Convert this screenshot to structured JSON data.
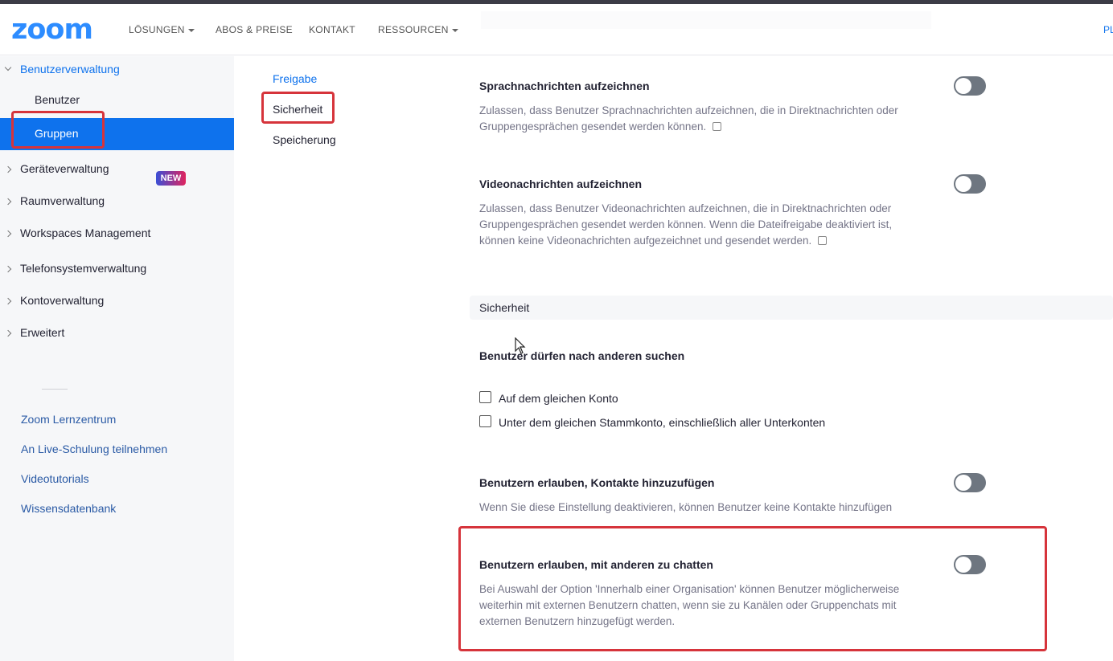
{
  "header": {
    "logo": "zoom",
    "nav": [
      {
        "label": "LÖSUNGEN",
        "dropdown": true
      },
      {
        "label": "ABOS & PREISE",
        "dropdown": false
      },
      {
        "label": "KONTAKT",
        "dropdown": false
      },
      {
        "label": "RESSOURCEN",
        "dropdown": true
      }
    ],
    "right_cut": "PL"
  },
  "sidebar": {
    "main": [
      {
        "label": "Benutzerverwaltung",
        "expanded": true
      },
      {
        "label": "Geräteverwaltung"
      },
      {
        "label": "Raumverwaltung"
      },
      {
        "label": "Workspaces Management",
        "badge": "NEW"
      },
      {
        "label": "Telefonsystemverwaltung"
      },
      {
        "label": "Kontoverwaltung"
      },
      {
        "label": "Erweitert"
      }
    ],
    "sub": [
      {
        "label": "Benutzer"
      },
      {
        "label": "Gruppen",
        "active": true
      }
    ],
    "links": [
      "Zoom Lernzentrum",
      "An Live-Schulung teilnehmen",
      "Videotutorials",
      "Wissensdatenbank"
    ]
  },
  "subnav": {
    "items": [
      "Freigabe",
      "Sicherheit",
      "Speicherung"
    ]
  },
  "settings": {
    "voice": {
      "title": "Sprachnachrichten aufzeichnen",
      "desc1": "Zulassen, dass Benutzer Sprachnachrichten aufzeichnen, die in Direktnachrichten oder",
      "desc2": "Gruppengesprächen gesendet werden können.",
      "enabled": false
    },
    "video": {
      "title": "Videonachrichten aufzeichnen",
      "desc1": "Zulassen, dass Benutzer Videonachrichten aufzeichnen, die in Direktnachrichten oder",
      "desc2": "Gruppengesprächen gesendet werden können. Wenn die Dateifreigabe deaktiviert ist,",
      "desc3": "können keine Videonachrichten aufgezeichnet und gesendet werden.",
      "enabled": false
    },
    "section": "Sicherheit",
    "search": {
      "title": "Benutzer dürfen nach anderen suchen",
      "opt1": "Auf dem gleichen Konto",
      "opt2": "Unter dem gleichen Stammkonto, einschließlich aller Unterkonten"
    },
    "contacts": {
      "title": "Benutzern erlauben, Kontakte hinzuzufügen",
      "desc": "Wenn Sie diese Einstellung deaktivieren, können Benutzer keine Kontakte hinzufügen",
      "enabled": false
    },
    "chat": {
      "title": "Benutzern erlauben, mit anderen zu chatten",
      "desc1": "Bei Auswahl der Option 'Innerhalb einer Organisation' können Benutzer möglicherweise",
      "desc2": "weiterhin mit externen Benutzern chatten, wenn sie zu Kanälen oder Gruppenchats mit",
      "desc3": "externen Benutzern hinzugefügt werden.",
      "enabled": false
    }
  },
  "colors": {
    "brand": "#2d8cff",
    "active": "#0e72ed",
    "highlight_box": "#d6343b"
  }
}
